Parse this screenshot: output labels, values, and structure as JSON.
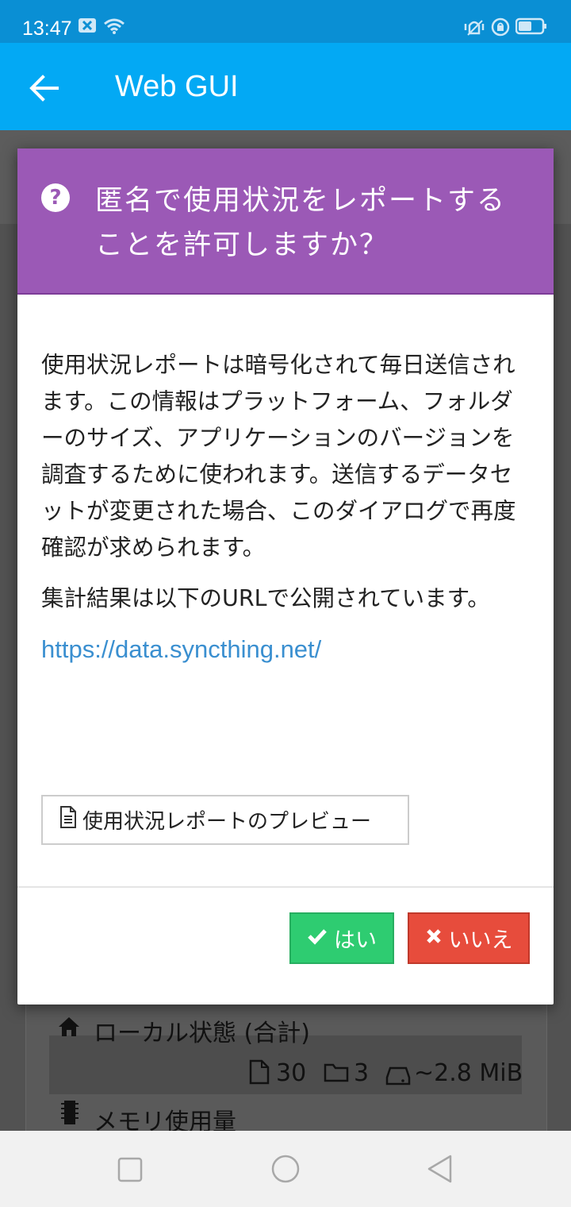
{
  "status_bar": {
    "time": "13:47"
  },
  "app_bar": {
    "title": "Web GUI"
  },
  "dialog": {
    "title": "匿名で使用状況をレポートすることを許可しますか？",
    "paragraph1": "使用状況レポートは暗号化されて毎日送信されます。この情報はプラットフォーム、フォルダーのサイズ、アプリケーションのバージョンを調査するために使われます。送信するデータセットが変更された場合、このダイアログで再度確認が求められます。",
    "paragraph2": "集計結果は以下のURLで公開されています。",
    "link": "https://data.syncthing.net/",
    "preview_label": "使用状況レポートのプレビュー",
    "yes_label": "はい",
    "no_label": "いいえ"
  },
  "background": {
    "local_state_label": "ローカル状態 (合計)",
    "files": "30",
    "folders": "3",
    "size": "~2.8 MiB",
    "memory_label": "メモリ使用量"
  },
  "colors": {
    "app_bar": "#03a9f4",
    "dialog_header": "#9b59b6",
    "yes_button": "#2ecc71",
    "no_button": "#e74c3c",
    "link": "#3a8fd0"
  }
}
